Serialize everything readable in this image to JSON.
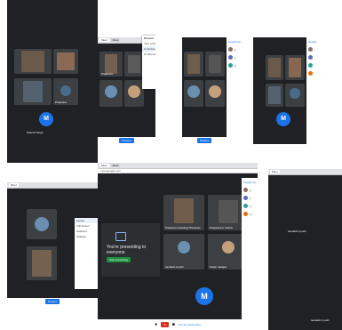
{
  "collage": {
    "cell1": {
      "tile_name": "Prasanna",
      "presenter": "Shanthi Singh",
      "bottom_name": "sandesh s.joshi"
    },
    "cell2": {
      "tile_name": "Prasanna",
      "popup_title": "Present"
    },
    "cell3": {
      "panel_tab": "People (6)"
    },
    "cell6": {
      "title": "You're presenting to everyone",
      "stop_label": "Stop presenting",
      "tile_prasanna": "Prasanna (Hosting) Presenter",
      "tile_prasanna2": "Prasanna tn Vishnu",
      "tile_sandesh": "sandesh k joshi",
      "tile_kedar": "Kedar natagar",
      "bottom_present": "You are presenting",
      "panel_tab": "People (6)",
      "side_name1": "sandesh k joshi",
      "side_name2": "sandesh k joshi"
    },
    "avatar_letter": "M",
    "colors": {
      "meet_dark": "#202124",
      "tile": "#3c4043",
      "blue": "#1a73e8",
      "stop_red": "#d93025",
      "green": "#1e8e3e"
    }
  }
}
